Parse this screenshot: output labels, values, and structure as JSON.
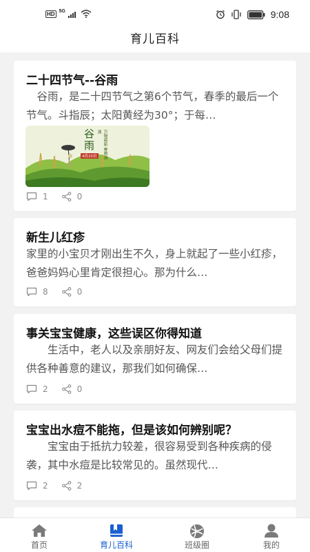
{
  "status_bar": {
    "hd": "HD",
    "network": "5G",
    "time": "9:08"
  },
  "header": {
    "title": "育儿百科"
  },
  "articles": [
    {
      "title": "二十四节气--谷雨",
      "excerpt": "　谷雨，是二十四节气之第6个节气，春季的最后一个节气。斗指辰；太阳黄经为30°；于每…",
      "comments": "1",
      "shares": "0",
      "image": {
        "big_text": "谷雨",
        "date": "4月20日",
        "side_text": "万物萌新 春雨淋漓"
      }
    },
    {
      "title": "新生儿红疹",
      "excerpt": "家里的小宝贝才刚出生不久，身上就起了一些小红疹，爸爸妈妈心里肯定很担心。那为什么…",
      "comments": "8",
      "shares": "0"
    },
    {
      "title": "事关宝宝健康，这些误区你得知道",
      "excerpt": "　　生活中，老人以及亲朋好友、网友们会给父母们提供各种善意的建议，那我们如何确保…",
      "comments": "2",
      "shares": "0"
    },
    {
      "title": "宝宝出水痘不能拖，但是该如何辨别呢？",
      "excerpt": "　　宝宝由于抵抗力较差，很容易受到各种疾病的侵袭，其中水痘是比较常见的。虽然现代…",
      "comments": "2",
      "shares": "2"
    }
  ],
  "tabs": [
    {
      "label": "首页",
      "icon": "home-icon"
    },
    {
      "label": "育儿百科",
      "icon": "book-icon",
      "active": true
    },
    {
      "label": "班级圈",
      "icon": "circle-icon"
    },
    {
      "label": "我的",
      "icon": "user-icon"
    }
  ],
  "colors": {
    "accent": "#1a5fd0",
    "background": "#f2f2f2",
    "card": "#ffffff"
  }
}
